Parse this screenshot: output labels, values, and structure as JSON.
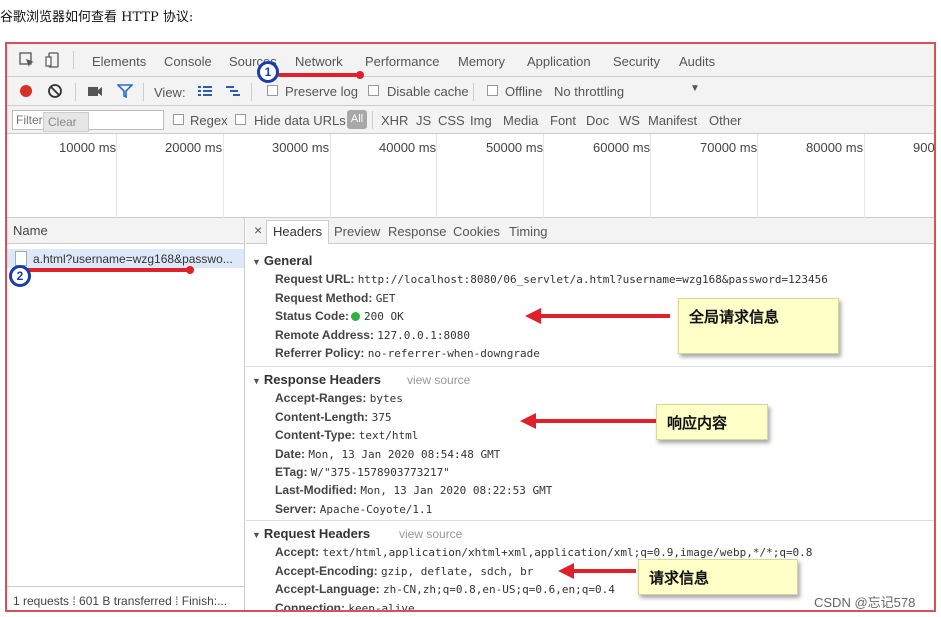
{
  "heading": "谷歌浏览器如何查看 HTTP 协议:",
  "tabs": [
    "Elements",
    "Console",
    "Sources",
    "Network",
    "Performance",
    "Memory",
    "Application",
    "Security",
    "Audits"
  ],
  "toolbar": {
    "view_label": "View:",
    "preserve_log": "Preserve log",
    "disable_cache": "Disable cache",
    "offline": "Offline",
    "throttling": "No throttling"
  },
  "filter": {
    "placeholder": "Filter",
    "tooltip": "Clear",
    "regex": "Regex",
    "hide_data_urls": "Hide data URLs",
    "all": "All",
    "types": [
      "XHR",
      "JS",
      "CSS",
      "Img",
      "Media",
      "Font",
      "Doc",
      "WS",
      "Manifest",
      "Other"
    ]
  },
  "timeline": {
    "ticks": [
      "10000 ms",
      "20000 ms",
      "30000 ms",
      "40000 ms",
      "50000 ms",
      "60000 ms",
      "70000 ms",
      "80000 ms",
      "900"
    ]
  },
  "left": {
    "name_header": "Name",
    "request": "a.html?username=wzg168&passwo...",
    "footer": "1 requests ⁞ 601 B transferred ⁞ Finish:..."
  },
  "detail_tabs": {
    "close": "×",
    "items": [
      "Headers",
      "Preview",
      "Response",
      "Cookies",
      "Timing"
    ]
  },
  "general": {
    "title": "General",
    "rows": [
      {
        "k": "Request URL:",
        "v": "http://localhost:8080/06_servlet/a.html?username=wzg168&password=123456"
      },
      {
        "k": "Request Method:",
        "v": "GET"
      },
      {
        "k": "Status Code:",
        "v": "200 OK"
      },
      {
        "k": "Remote Address:",
        "v": "127.0.0.1:8080"
      },
      {
        "k": "Referrer Policy:",
        "v": "no-referrer-when-downgrade"
      }
    ]
  },
  "response_headers": {
    "title": "Response Headers",
    "view_source": "view source",
    "rows": [
      {
        "k": "Accept-Ranges:",
        "v": "bytes"
      },
      {
        "k": "Content-Length:",
        "v": "375"
      },
      {
        "k": "Content-Type:",
        "v": "text/html"
      },
      {
        "k": "Date:",
        "v": "Mon, 13 Jan 2020 08:54:48 GMT"
      },
      {
        "k": "ETag:",
        "v": "W/\"375-1578903773217\""
      },
      {
        "k": "Last-Modified:",
        "v": "Mon, 13 Jan 2020 08:22:53 GMT"
      },
      {
        "k": "Server:",
        "v": "Apache-Coyote/1.1"
      }
    ]
  },
  "request_headers": {
    "title": "Request Headers",
    "view_source": "view source",
    "rows": [
      {
        "k": "Accept:",
        "v": "text/html,application/xhtml+xml,application/xml;q=0.9,image/webp,*/*;q=0.8"
      },
      {
        "k": "Accept-Encoding:",
        "v": "gzip, deflate, sdch, br"
      },
      {
        "k": "Accept-Language:",
        "v": "zh-CN,zh;q=0.8,en-US;q=0.6,en;q=0.4"
      },
      {
        "k": "Connection:",
        "v": "keep-alive"
      }
    ]
  },
  "annotations": {
    "n1": "1",
    "n2": "2",
    "note1": "全局请求信息",
    "note2": "响应内容",
    "note3": "请求信息"
  },
  "watermark": "CSDN @忘记578",
  "colors": {
    "annotation_red": "#e0202a",
    "marker_blue": "#1a3ea8",
    "note_bg": "#ffffc8",
    "record_red": "#d93025",
    "status_green": "#2db33a"
  }
}
